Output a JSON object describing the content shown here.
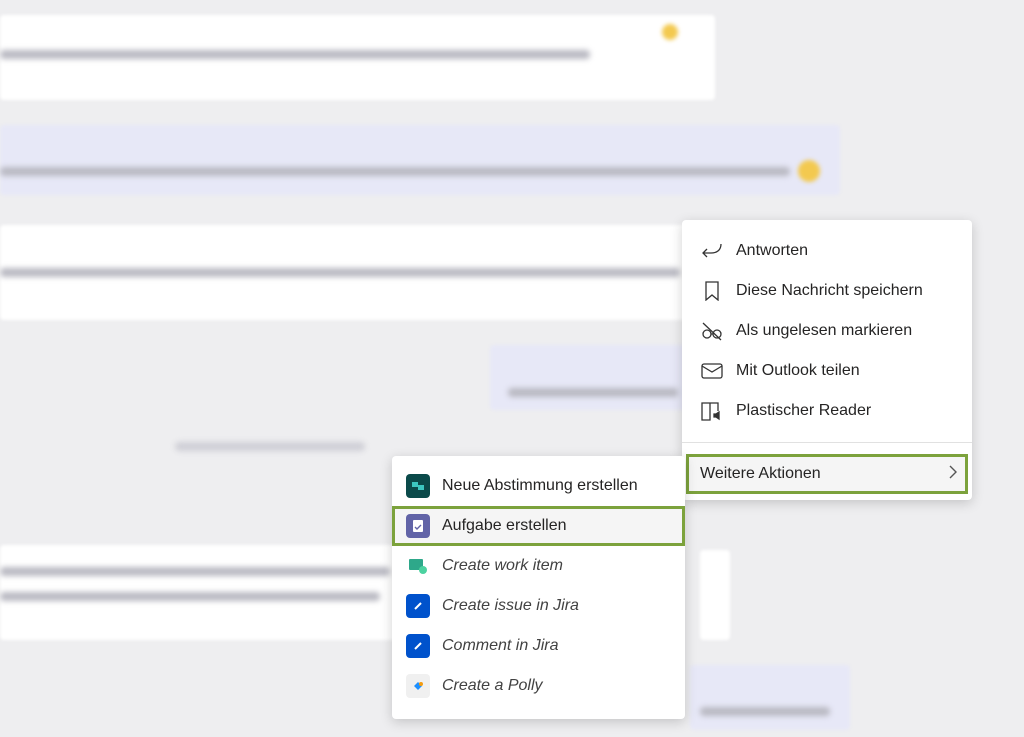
{
  "context_menu": {
    "items": [
      {
        "label": "Antworten",
        "icon": "reply-icon"
      },
      {
        "label": "Diese Nachricht speichern",
        "icon": "bookmark-icon"
      },
      {
        "label": "Als ungelesen markieren",
        "icon": "unread-glasses-icon"
      },
      {
        "label": "Mit Outlook teilen",
        "icon": "mail-icon"
      },
      {
        "label": "Plastischer Reader",
        "icon": "immersive-reader-icon"
      }
    ],
    "more_actions": "Weitere Aktionen"
  },
  "submenu": {
    "items": [
      {
        "label": "Neue Abstimmung erstellen",
        "icon": "forms-poll-icon",
        "color": "#0b4a4a"
      },
      {
        "label": "Aufgabe erstellen",
        "icon": "tasks-icon",
        "color": "#6264a7"
      },
      {
        "label": "Create work item",
        "icon": "azure-boards-icon",
        "color": "#2ea88a"
      },
      {
        "label": "Create issue in Jira",
        "icon": "jira-icon",
        "color": "#0052cc"
      },
      {
        "label": "Comment in Jira",
        "icon": "jira-icon",
        "color": "#0052cc"
      },
      {
        "label": "Create a Polly",
        "icon": "polly-icon",
        "color": "#f0f0f0"
      }
    ]
  },
  "colors": {
    "highlight": "#7ca23c"
  }
}
